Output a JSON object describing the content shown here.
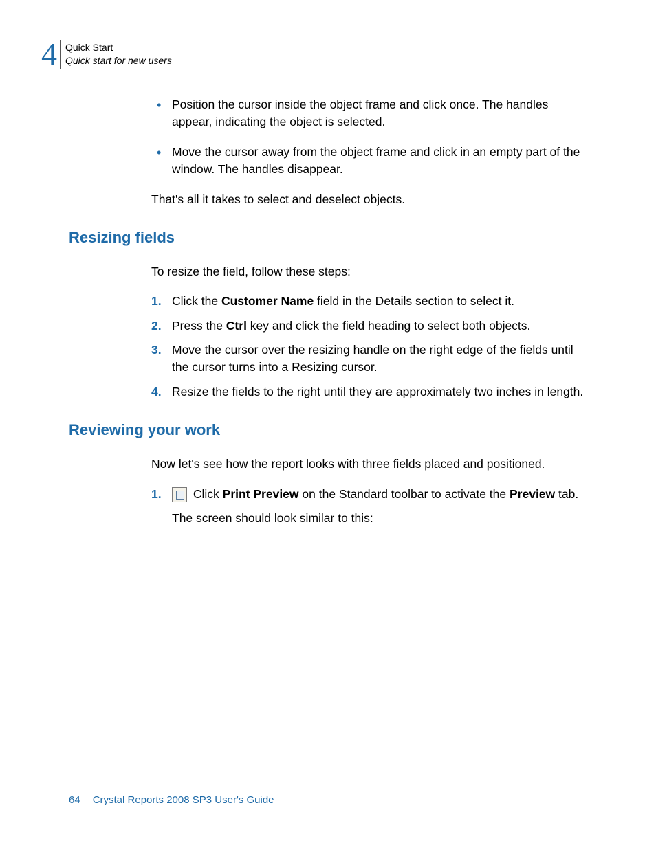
{
  "header": {
    "chapter_number": "4",
    "title_main": "Quick Start",
    "title_sub": "Quick start for new users"
  },
  "intro": {
    "bullet1": "Position the cursor inside the object frame and click once. The handles appear, indicating the object is selected.",
    "bullet2": "Move the cursor away from the object frame and click in an empty part of the window. The handles disappear.",
    "closing": "That's all it takes to select and deselect objects."
  },
  "section1": {
    "heading": "Resizing fields",
    "intro": "To resize the field, follow these steps:",
    "step1_pre": "Click the ",
    "step1_bold": "Customer Name",
    "step1_post": " field in the Details section to select it.",
    "step2_pre": "Press the ",
    "step2_bold": "Ctrl",
    "step2_post": " key and click the field heading to select both objects.",
    "step3": "Move the cursor over the resizing handle on the right edge of the fields until the cursor turns into a Resizing cursor.",
    "step4": "Resize the fields to the right until they are approximately two inches in length."
  },
  "section2": {
    "heading": "Reviewing your work",
    "intro": "Now let's see how the report looks with three fields placed and positioned.",
    "step1_pre": " Click ",
    "step1_bold1": "Print Preview",
    "step1_mid": " on the Standard toolbar to activate the ",
    "step1_bold2": "Preview",
    "step1_post": " tab.",
    "step1_followup": "The screen should look similar to this:"
  },
  "footer": {
    "page": "64",
    "book": "Crystal Reports 2008 SP3 User's Guide"
  }
}
